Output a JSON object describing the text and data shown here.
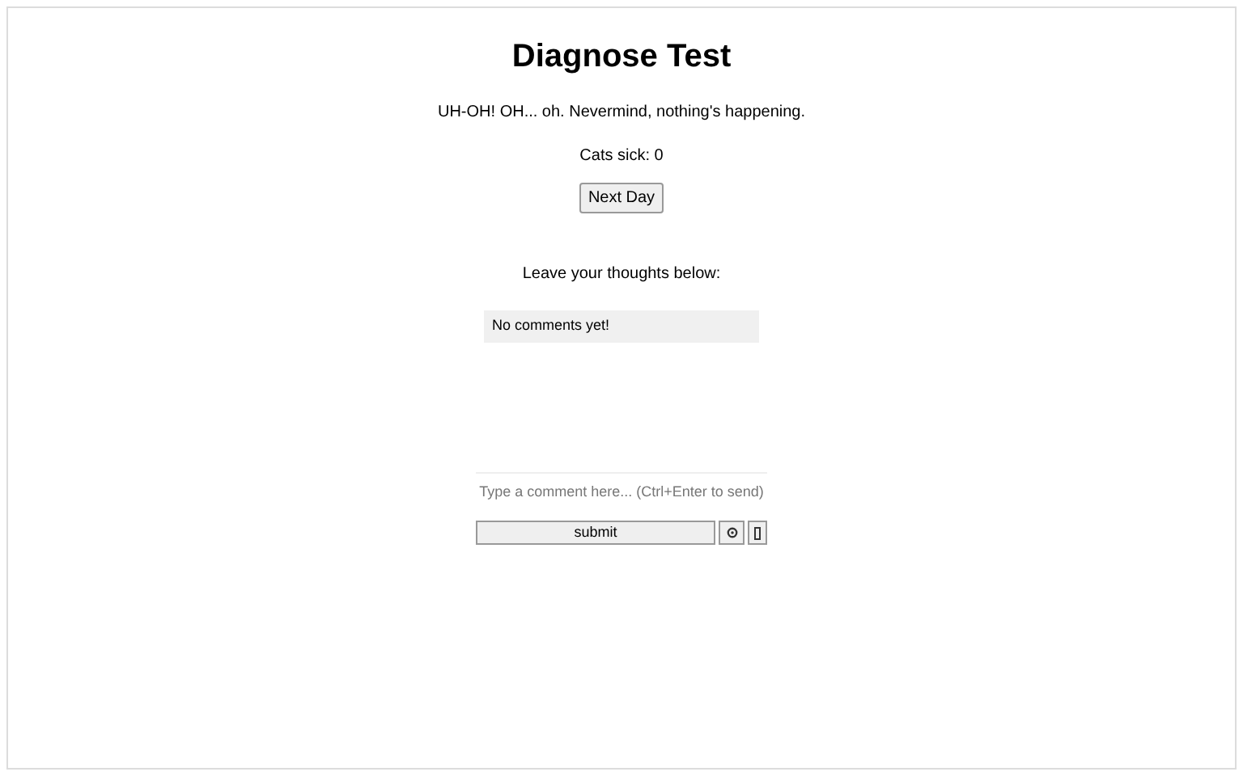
{
  "title": "Diagnose Test",
  "message": "UH-OH! OH... oh. Nevermind, nothing's happening.",
  "counter": "Cats sick: 0",
  "next_button": "Next Day",
  "comments_heading": "Leave your thoughts below:",
  "comments_empty": "No comments yet!",
  "comment_field": {
    "placeholder": "Type a comment here... (Ctrl+Enter to send)"
  },
  "submit_button": "submit"
}
